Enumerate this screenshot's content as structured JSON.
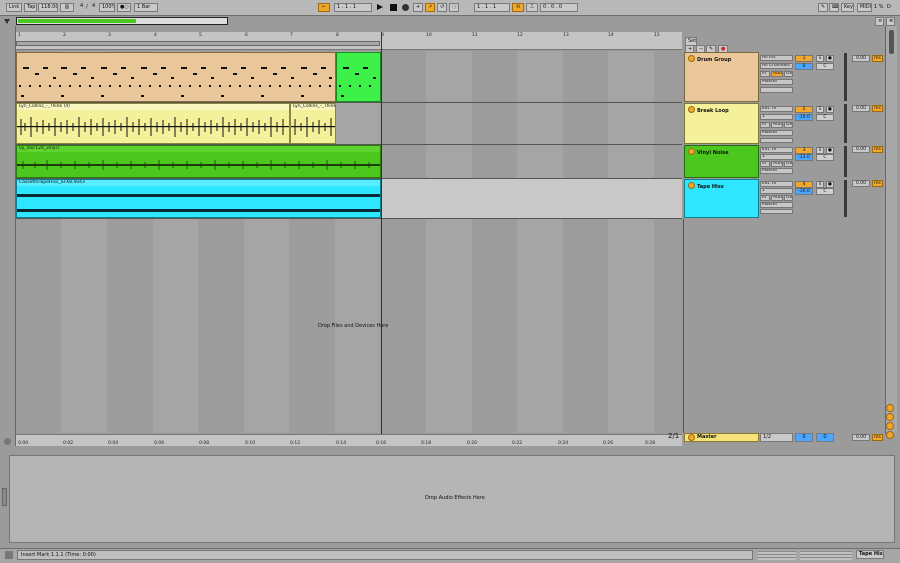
{
  "toolbar": {
    "link": "Link",
    "tap": "Tap",
    "tempo": "118.00",
    "metro_icon": "metronome-icon",
    "signature_num": "4",
    "signature_sep": "/",
    "signature_den": "4",
    "groove": "100%",
    "quantize": "1 Bar",
    "arrangement_position": "1 .   1 .   1",
    "loop_start": "1 .   1 .   1",
    "loop_length": "0 .   0 .   0",
    "key": "Key",
    "midi": "MIDI",
    "cpu": "1 %",
    "disk": "D"
  },
  "ruler": {
    "bars": [
      "1",
      "2",
      "3",
      "4",
      "5",
      "6",
      "7",
      "8",
      "9",
      "10",
      "11",
      "12",
      "13",
      "14",
      "15"
    ],
    "times": [
      "0:00",
      "0:02",
      "0:04",
      "0:06",
      "0:08",
      "0:10",
      "0:12",
      "0:14",
      "0:16",
      "0:18",
      "0:20",
      "0:22",
      "0:24",
      "0:26",
      "0:28"
    ]
  },
  "arrangement": {
    "drop_hint": "Drop Files and Devices Here",
    "set_label": "Set",
    "zoom_ratio": "2/1"
  },
  "tracks": [
    {
      "name": "Drum Group",
      "color": "#e9c79a",
      "clips": [],
      "input": "All Ins",
      "channel": "All Channels",
      "monitor": [
        "In",
        "Auto",
        "Off"
      ],
      "output": "Master",
      "number": "1",
      "volume": "0",
      "pan": "C",
      "delay": "0.00",
      "delay_unit": "ms"
    },
    {
      "name": "Break Loop",
      "color": "#f5f09a",
      "clips": [
        "Lyn_Collins_-_Think (4)",
        "Lyn_Collins_-_Think"
      ],
      "input": "Ext. In",
      "channel": "1",
      "monitor": [
        "In",
        "Auto",
        "Off"
      ],
      "output": "Master",
      "number": "2",
      "volume": "-10.0",
      "pan": "C",
      "delay": "0.00",
      "delay_unit": "ms"
    },
    {
      "name": "Vinyl Noise",
      "color": "#4cc71e",
      "clips": [
        "vy_noir124_vinyl7"
      ],
      "input": "Ext. In",
      "channel": "1",
      "monitor": [
        "In",
        "Auto",
        "Off"
      ],
      "output": "Master",
      "number": "3",
      "volume": "-13.0",
      "pan": "C",
      "delay": "0.00",
      "delay_unit": "ms"
    },
    {
      "name": "Tape Hiss",
      "color": "#2ee6ff",
      "clips": [
        "CassetteTapeHiss_SFX8.4043"
      ],
      "input": "Ext. In",
      "channel": "1",
      "monitor": [
        "In",
        "Auto",
        "Off"
      ],
      "output": "Master",
      "number": "4",
      "volume": "-30.0",
      "pan": "C",
      "delay": "0.00",
      "delay_unit": "ms"
    }
  ],
  "master": {
    "name": "Master",
    "color": "#f5e27a",
    "output": "1/2",
    "volume": "0",
    "pan": "0",
    "delay": "0.00",
    "delay_unit": "ms"
  },
  "detail": {
    "drop_hint": "Drop Audio Effects Here"
  },
  "status": {
    "message": "Insert Mark 1.1.1 (Time: 0:00)",
    "selected_track": "Tape Hiss"
  }
}
